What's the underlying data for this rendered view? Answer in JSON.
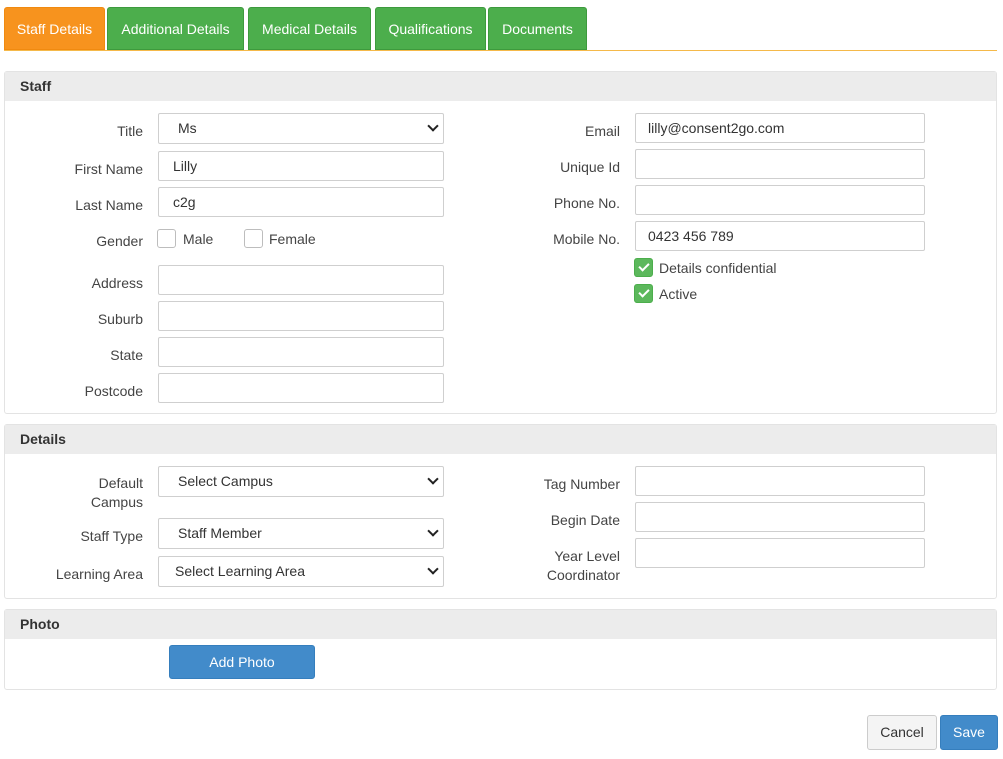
{
  "tabs": [
    "Staff Details",
    "Additional Details",
    "Medical Details",
    "Qualifications",
    "Documents"
  ],
  "staff": {
    "heading": "Staff",
    "title_label": "Title",
    "title_value": "Ms",
    "first_name_label": "First Name",
    "first_name_value": "Lilly",
    "last_name_label": "Last Name",
    "last_name_value": "c2g",
    "gender_label": "Gender",
    "gender_male": "Male",
    "gender_female": "Female",
    "address_label": "Address",
    "address_value": "",
    "suburb_label": "Suburb",
    "suburb_value": "",
    "state_label": "State",
    "state_value": "",
    "postcode_label": "Postcode",
    "postcode_value": "",
    "email_label": "Email",
    "email_value": "lilly@consent2go.com",
    "unique_id_label": "Unique Id",
    "unique_id_value": "",
    "phone_label": "Phone No.",
    "phone_value": "",
    "mobile_label": "Mobile No.",
    "mobile_value": "0423 456 789",
    "confidential_label": "Details confidential",
    "active_label": "Active"
  },
  "details": {
    "heading": "Details",
    "campus_label": "Default Campus",
    "campus_value": "Select Campus",
    "staff_type_label": "Staff Type",
    "staff_type_value": "Staff Member",
    "learning_area_label": "Learning Area",
    "learning_area_value": "Select Learning Area",
    "tag_label": "Tag Number",
    "tag_value": "",
    "begin_date_label": "Begin Date",
    "begin_date_value": "",
    "year_level_label": "Year Level Coordinator",
    "year_level_value": ""
  },
  "photo": {
    "heading": "Photo",
    "add_photo_label": "Add Photo"
  },
  "footer": {
    "cancel_label": "Cancel",
    "save_label": "Save"
  },
  "colors": {
    "tab_active": "#f7931e",
    "tab": "#4cae4c",
    "primary": "#428bca",
    "check": "#5cb85c"
  }
}
